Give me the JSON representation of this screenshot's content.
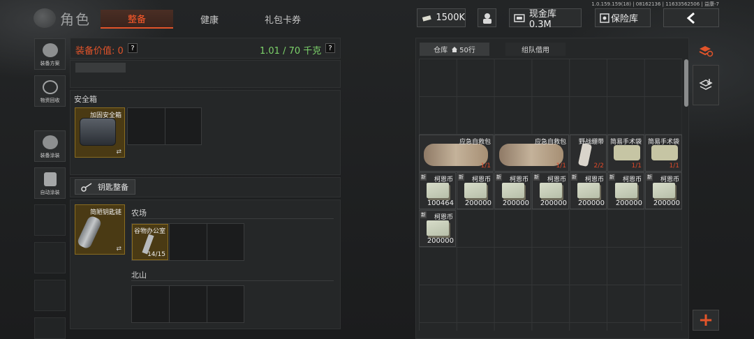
{
  "header": {
    "title": "角色",
    "tabs": [
      "整备",
      "健康",
      "礼包卡券"
    ],
    "build_info": "1.0.159.159(18) | 08162136 | 11633562506 | 益康-7",
    "currency_amount": "1500K",
    "cash_storage": "现金库 0.3M",
    "vault": "保险库"
  },
  "sidebar": {
    "items": [
      {
        "label": "装备方案",
        "icon": "helmet-gear-icon"
      },
      {
        "label": "物资回收",
        "icon": "recycle-icon"
      },
      {
        "label": "装备涂装",
        "icon": "paint-helmet-icon"
      },
      {
        "label": "自动涂装",
        "icon": "auto-paint-icon"
      }
    ]
  },
  "left_panel": {
    "value_label": "装备价值: 0",
    "help": "?",
    "weight": "1.01 / 70 千克",
    "safe_box_section": "安全箱",
    "safe_box_item": "加固安全箱",
    "keys_button": "钥匙整备",
    "keychain_item": "简陋钥匙链",
    "farm_label": "农场",
    "key_item": "谷物办公室",
    "key_count": "14/15",
    "north_label": "北山",
    "swap_symbol": "⇄"
  },
  "warehouse": {
    "tabs": [
      "仓库",
      "50行",
      "组队借用"
    ],
    "items_row1": [
      {
        "name": "应急自救包",
        "count": "1/1",
        "kind": "medkit"
      },
      {
        "name": "应急自救包",
        "count": "1/1",
        "kind": "medkit"
      },
      {
        "name": "野战绷带",
        "count": "2/2",
        "kind": "bandage"
      },
      {
        "name": "简易手术袋",
        "count": "1/1",
        "kind": "pouch"
      },
      {
        "name": "简易手术袋",
        "count": "1/1",
        "kind": "pouch"
      }
    ],
    "cash_items": [
      {
        "name": "柯恩币",
        "amount": "100464",
        "badge": "新"
      },
      {
        "name": "柯恩币",
        "amount": "200000",
        "badge": "新"
      },
      {
        "name": "柯恩币",
        "amount": "200000",
        "badge": "新"
      },
      {
        "name": "柯恩币",
        "amount": "200000",
        "badge": "新"
      },
      {
        "name": "柯恩币",
        "amount": "200000",
        "badge": "新"
      },
      {
        "name": "柯恩币",
        "amount": "200000",
        "badge": "新"
      },
      {
        "name": "柯恩币",
        "amount": "200000",
        "badge": "新"
      },
      {
        "name": "柯恩币",
        "amount": "200000",
        "badge": "新"
      }
    ],
    "add_button": "+"
  },
  "colors": {
    "accent": "#e2542a",
    "weight_green": "#7cd26a",
    "item_gold": "#8a6c20"
  }
}
